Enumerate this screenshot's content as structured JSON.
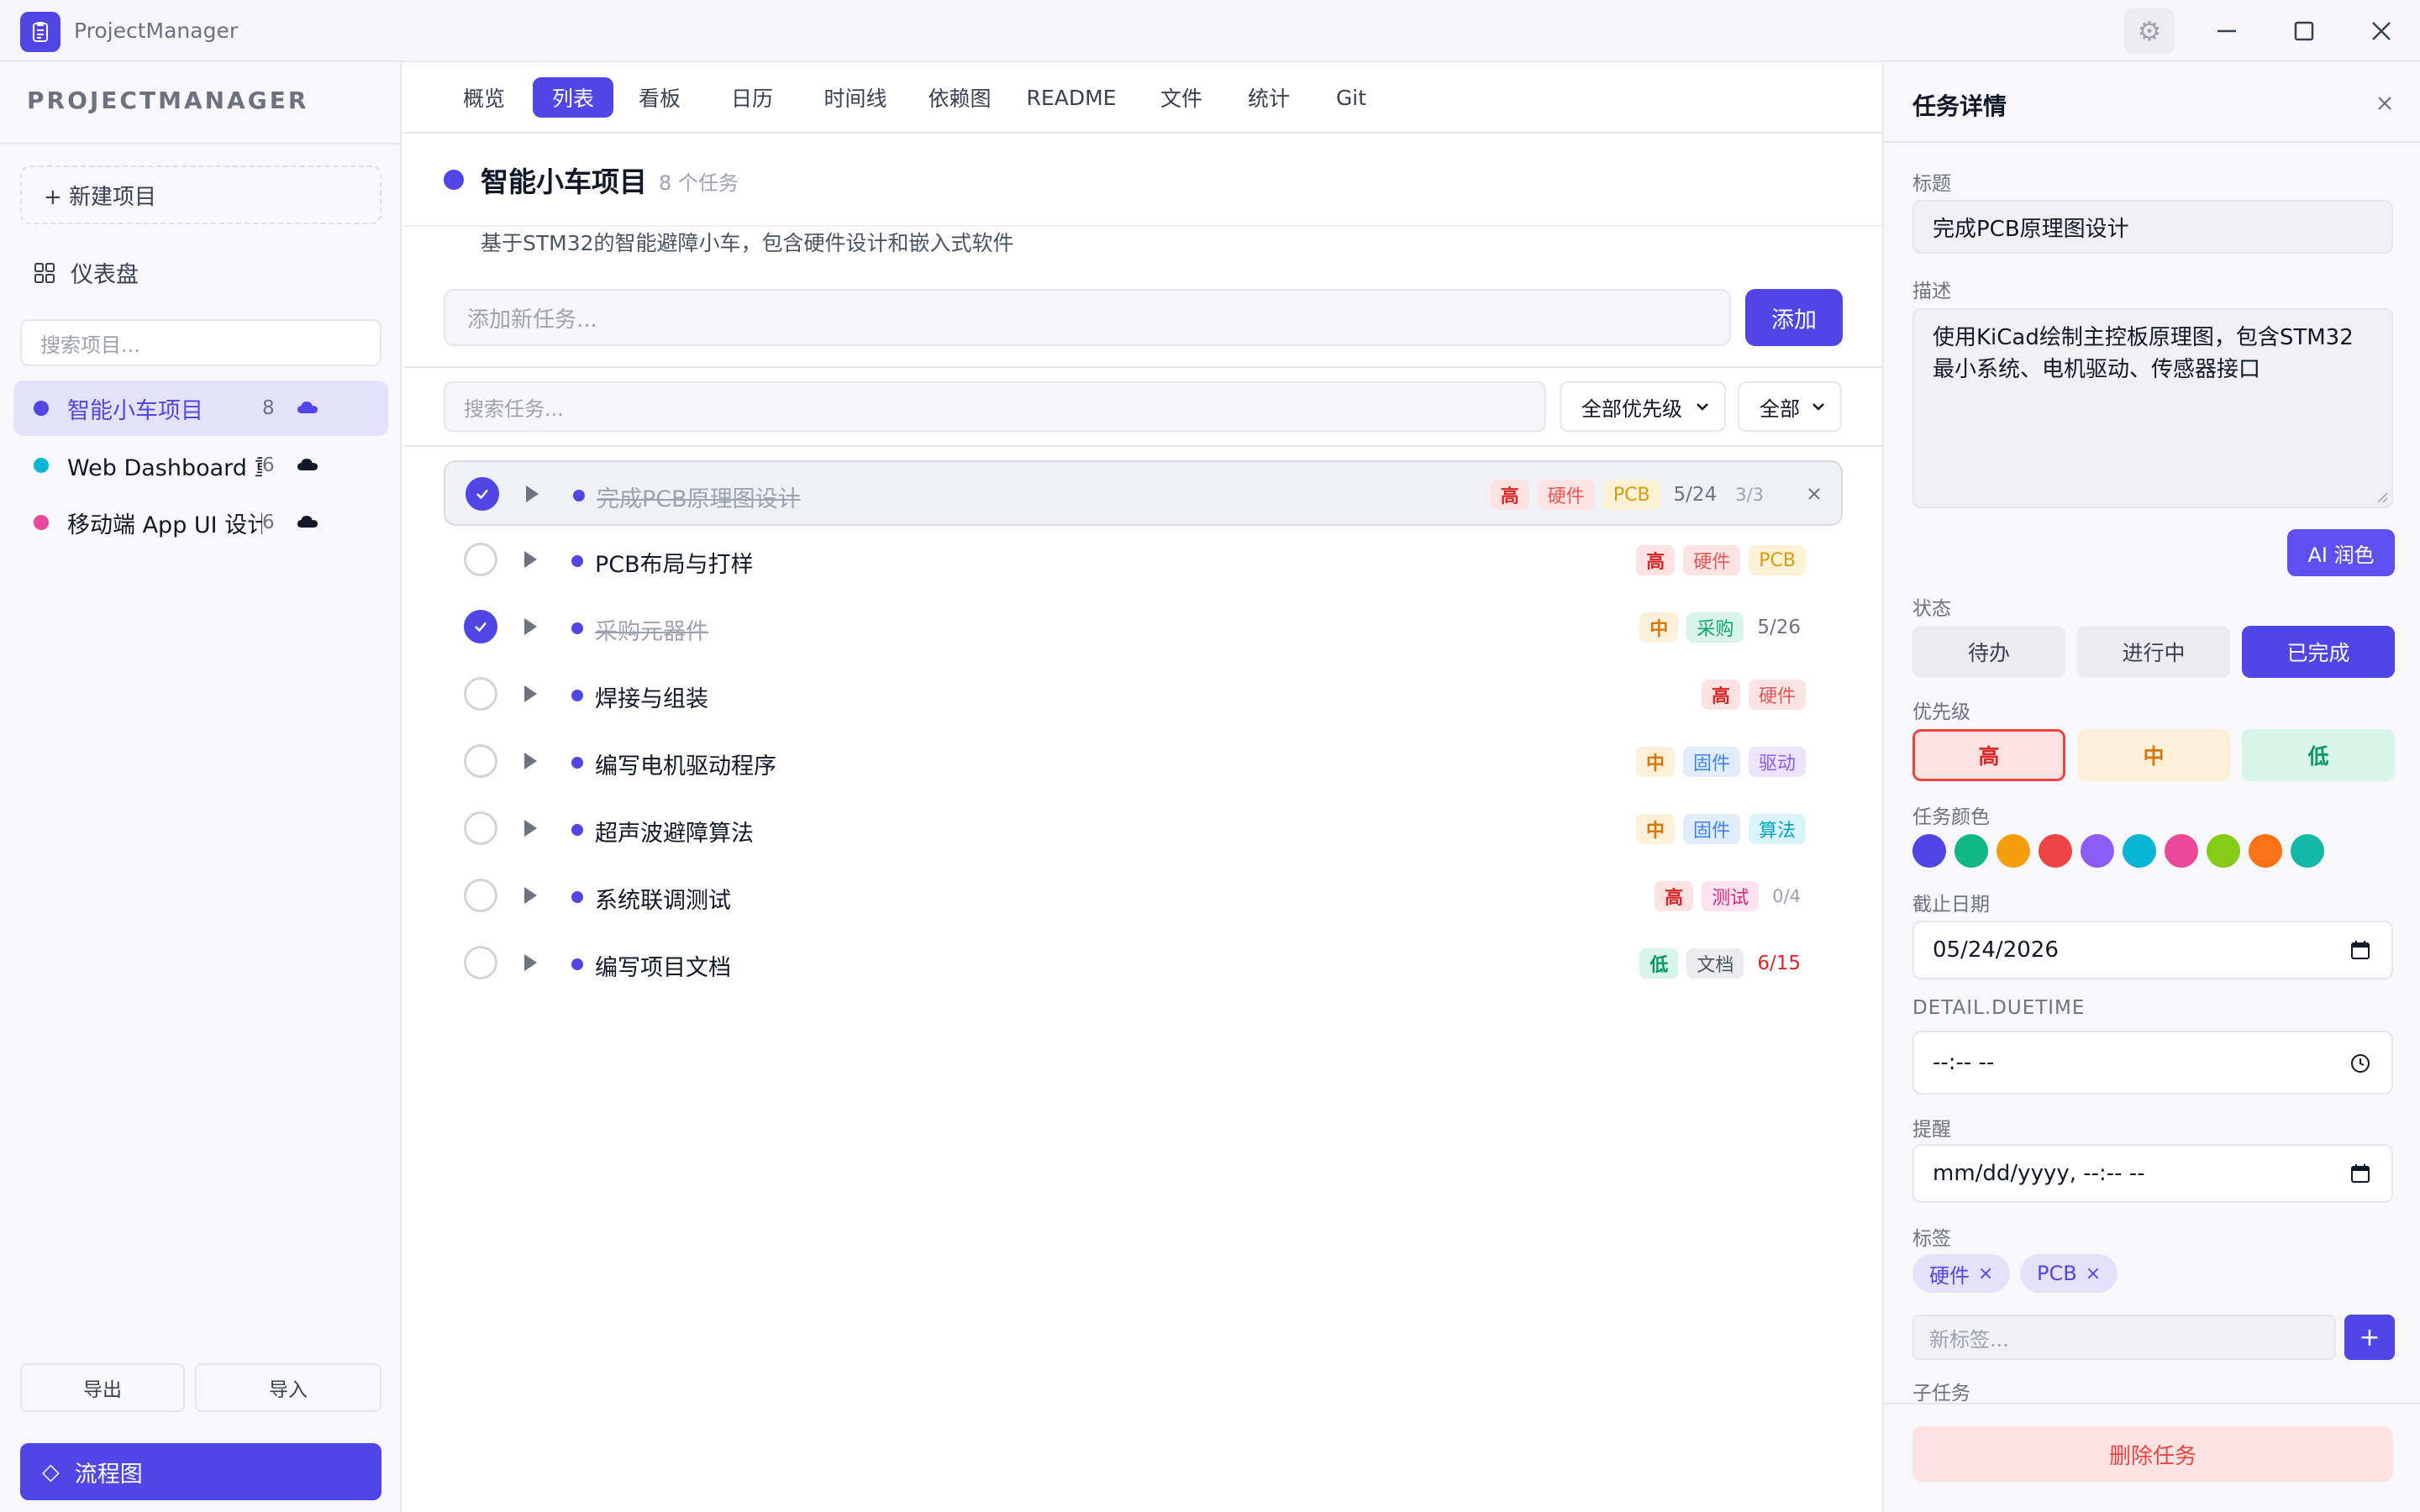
{
  "window": {
    "title": "ProjectManager",
    "settings_glyph": "⚙",
    "icons": [
      "app-logo-icon",
      "settings-icon",
      "minimize-icon",
      "maximize-icon",
      "close-icon"
    ]
  },
  "sidebar": {
    "brand": "PROJECTMANAGER",
    "new_project": "+ 新建项目",
    "dashboard": "仪表盘",
    "search_placeholder": "搜索项目...",
    "projects": [
      {
        "name": "智能小车项目",
        "count": "8",
        "color": "#4f46e5"
      },
      {
        "name": "Web Dashboard 重构",
        "count": "6",
        "color": "#06b6d4"
      },
      {
        "name": "移动端 App UI 设计",
        "count": "6",
        "color": "#ec4899"
      }
    ],
    "export": "导出",
    "import": "导入",
    "flowchart": "流程图",
    "flowchart_glyph": "◇"
  },
  "tabs": [
    "概览",
    "列表",
    "看板",
    "日历",
    "时间线",
    "依赖图",
    "README",
    "文件",
    "统计",
    "Git"
  ],
  "active_tab": "列表",
  "project": {
    "title": "智能小车项目",
    "task_count": "8 个任务",
    "description": "基于STM32的智能避障小车，包含硬件设计和嵌入式软件",
    "color": "#4f46e5"
  },
  "add_task": {
    "placeholder": "添加新任务...",
    "button": "添加"
  },
  "filters": {
    "search_placeholder": "搜索任务...",
    "priority": "全部优先级",
    "status": "全部"
  },
  "tasks": [
    {
      "title": "完成PCB原理图设计",
      "done": true,
      "priority": "高",
      "tags": [
        "硬件",
        "PCB"
      ],
      "due": "5/24",
      "subtasks": "3/3"
    },
    {
      "title": "PCB布局与打样",
      "done": false,
      "priority": "高",
      "tags": [
        "硬件",
        "PCB"
      ],
      "due": "",
      "subtasks": ""
    },
    {
      "title": "采购元器件",
      "done": true,
      "priority": "中",
      "tags": [
        "采购"
      ],
      "due": "5/26",
      "subtasks": ""
    },
    {
      "title": "焊接与组装",
      "done": false,
      "priority": "高",
      "tags": [
        "硬件"
      ],
      "due": "",
      "subtasks": ""
    },
    {
      "title": "编写电机驱动程序",
      "done": false,
      "priority": "中",
      "tags": [
        "固件",
        "驱动"
      ],
      "due": "",
      "subtasks": ""
    },
    {
      "title": "超声波避障算法",
      "done": false,
      "priority": "中",
      "tags": [
        "固件",
        "算法"
      ],
      "due": "",
      "subtasks": ""
    },
    {
      "title": "系统联调测试",
      "done": false,
      "priority": "高",
      "tags": [
        "测试"
      ],
      "due": "",
      "subtasks": "0/4"
    },
    {
      "title": "编写项目文档",
      "done": false,
      "priority": "低",
      "tags": [
        "文档"
      ],
      "due": "6/15",
      "subtasks": ""
    }
  ],
  "detail": {
    "header": "任务详情",
    "title_label": "标题",
    "title_value": "完成PCB原理图设计",
    "desc_label": "描述",
    "desc_value": "使用KiCad绘制主控板原理图，包含STM32最小系统、电机驱动、传感器接口",
    "ai_button": "AI 润色",
    "status_label": "状态",
    "status_options": [
      "待办",
      "进行中",
      "已完成"
    ],
    "status_selected": "已完成",
    "priority_label": "优先级",
    "priority_options": [
      "高",
      "中",
      "低"
    ],
    "priority_selected": "高",
    "color_label": "任务颜色",
    "colors": [
      "#4f46e5",
      "#10b981",
      "#f59e0b",
      "#ef4444",
      "#8b5cf6",
      "#06b6d4",
      "#ec4899",
      "#84cc16",
      "#f97316",
      "#14b8a6"
    ],
    "due_label": "截止日期",
    "due_value": "05/24/2026",
    "duetime_label": "DETAIL.DUETIME",
    "duetime_value": "--:-- --",
    "reminder_label": "提醒",
    "reminder_value": "mm/dd/yyyy, --:-- --",
    "tags_label": "标签",
    "tags": [
      "硬件",
      "PCB"
    ],
    "tag_remove_glyph": "×",
    "new_tag_placeholder": "新标签...",
    "add_tag_glyph": "+",
    "subtasks_label": "子任务",
    "delete_button": "删除任务"
  }
}
